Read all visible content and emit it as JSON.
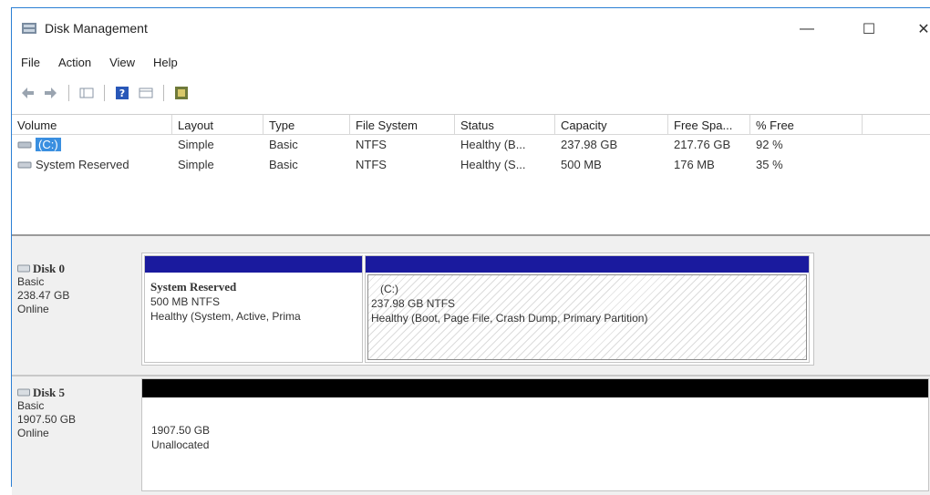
{
  "window": {
    "title": "Disk Management",
    "minimize": "—",
    "maximize": "☐",
    "close": "✕"
  },
  "menu": [
    "File",
    "Action",
    "View",
    "Help"
  ],
  "volume_list": {
    "columns": [
      "Volume",
      "Layout",
      "Type",
      "File System",
      "Status",
      "Capacity",
      "Free Spa...",
      "% Free",
      ""
    ],
    "rows": [
      {
        "volume": "(C:)",
        "layout": "Simple",
        "type": "Basic",
        "fs": "NTFS",
        "status": "Healthy (B...",
        "capacity": "237.98 GB",
        "free": "217.76 GB",
        "pct": "92 %"
      },
      {
        "volume": "System Reserved",
        "layout": "Simple",
        "type": "Basic",
        "fs": "NTFS",
        "status": "Healthy (S...",
        "capacity": "500 MB",
        "free": "176 MB",
        "pct": "35 %"
      }
    ]
  },
  "disks": [
    {
      "name": "Disk 0",
      "type": "Basic",
      "size": "238.47 GB",
      "state": "Online",
      "partitions": [
        {
          "label": "System Reserved",
          "size": "500 MB NTFS",
          "status": "Healthy (System, Active, Prima"
        },
        {
          "label": "(C:)",
          "size": "237.98 GB NTFS",
          "status": "Healthy (Boot, Page File, Crash Dump, Primary Partition)"
        }
      ]
    },
    {
      "name": "Disk 5",
      "type": "Basic",
      "size": "1907.50 GB",
      "state": "Online",
      "partitions": [
        {
          "size": "1907.50 GB",
          "status": "Unallocated"
        }
      ]
    }
  ],
  "colors": {
    "primary_bar": "#1a1a9e",
    "unallocated_bar": "#000000",
    "selection": "#3a8fe0"
  }
}
